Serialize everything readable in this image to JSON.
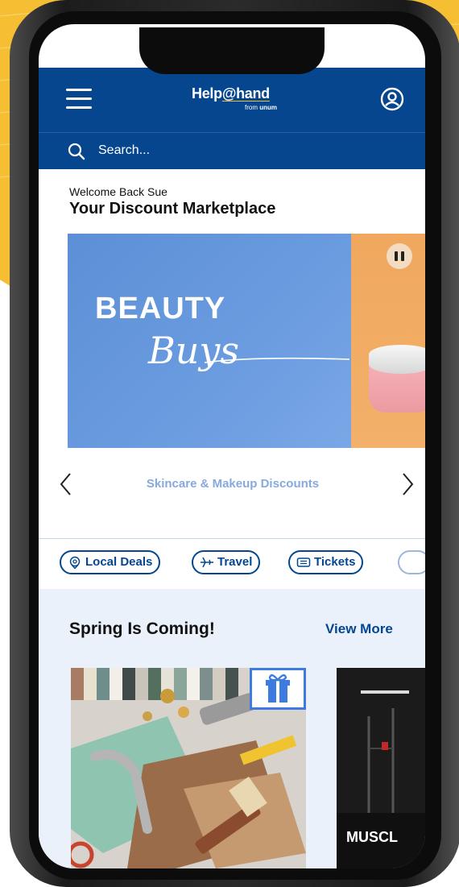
{
  "header": {
    "logo_main_prefix": "Help",
    "logo_main_at": "@",
    "logo_main_suffix": "hand",
    "logo_sub_prefix": "from",
    "logo_sub_brand": "unum"
  },
  "search": {
    "placeholder": "Search..."
  },
  "welcome": {
    "greeting": "Welcome Back Sue",
    "title": "Your Discount Marketplace"
  },
  "banner": {
    "word": "BEAUTY",
    "script": "Buys",
    "caption": "Skincare & Makeup Discounts"
  },
  "chips": [
    {
      "label": "Local Deals",
      "icon": "map-pin-icon"
    },
    {
      "label": "Travel",
      "icon": "plane-icon"
    },
    {
      "label": "Tickets",
      "icon": "ticket-icon"
    }
  ],
  "section": {
    "title": "Spring Is Coming!",
    "view_more": "View More"
  },
  "cards": [
    {
      "label": ""
    },
    {
      "label": "MUSCL"
    }
  ],
  "colors": {
    "brand_blue": "#05468f",
    "accent_yellow": "#f6bf33",
    "caption_blue": "#86a9de"
  }
}
